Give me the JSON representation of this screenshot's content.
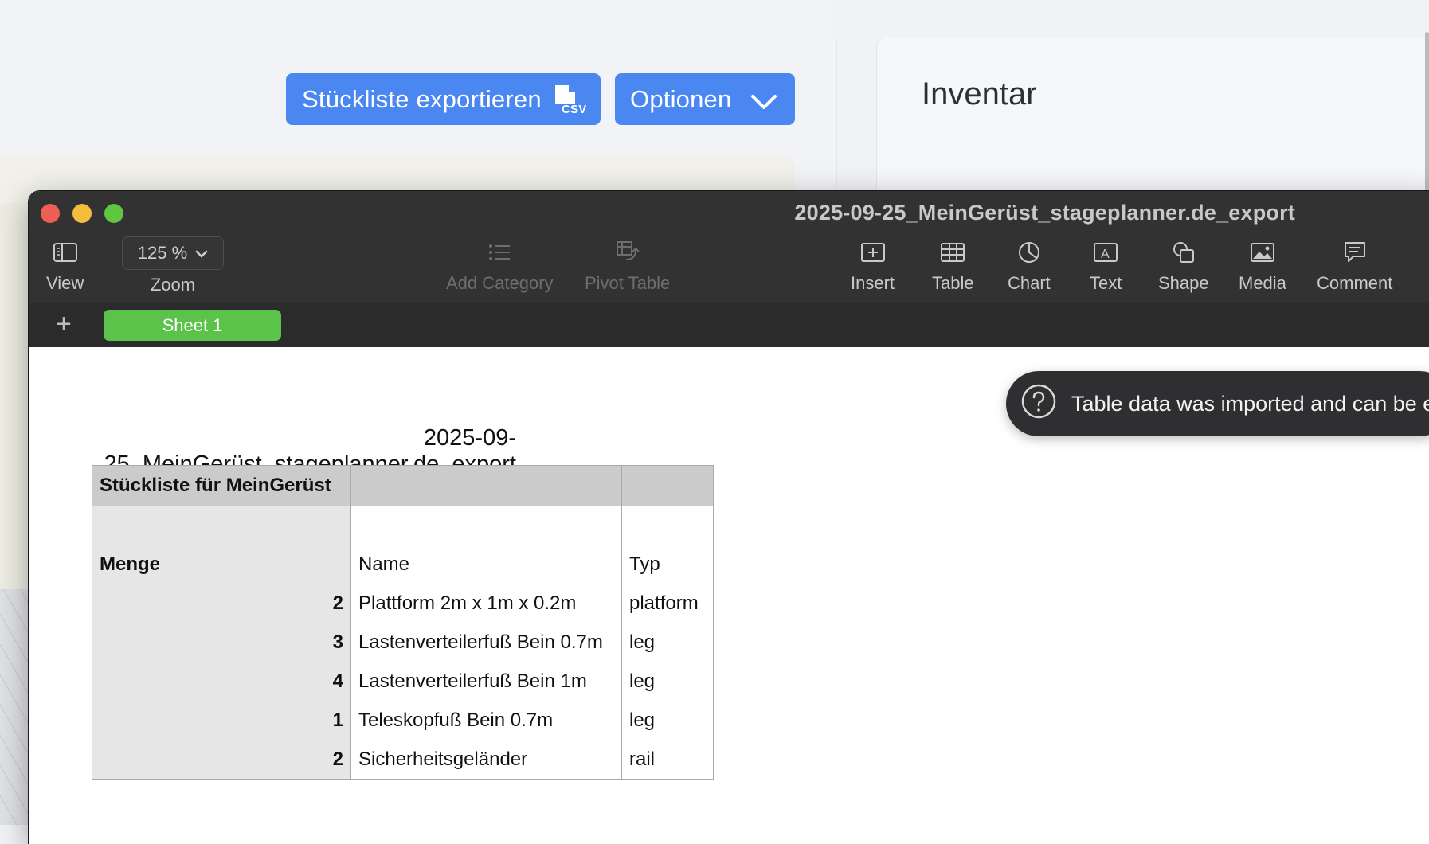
{
  "app": {
    "export_button_label": "Stückliste exportieren",
    "options_button_label": "Optionen",
    "inventory_title": "Inventar"
  },
  "window": {
    "title": "2025-09-25_MeinGerüst_stageplanner.de_export",
    "toolbar": {
      "view": "View",
      "zoom_value": "125 %",
      "zoom": "Zoom",
      "add_category": "Add Category",
      "pivot_table": "Pivot Table",
      "insert": "Insert",
      "table": "Table",
      "chart": "Chart",
      "text": "Text",
      "shape": "Shape",
      "media": "Media",
      "comment": "Comment"
    },
    "sheet_tab": "Sheet 1",
    "doc_title": "2025-09-25_MeinGerüst_stageplanner.de_export",
    "toast": "Table data was imported and can be edited"
  },
  "table": {
    "header": [
      "Stückliste für MeinGerüst",
      "",
      ""
    ],
    "blank_row": [
      "",
      "",
      ""
    ],
    "column_row": [
      "Menge",
      "Name",
      "Typ"
    ],
    "rows": [
      {
        "qty": "2",
        "name": "Plattform 2m x 1m x 0.2m",
        "type": "platform"
      },
      {
        "qty": "3",
        "name": "Lastenverteilerfuß Bein 0.7m",
        "type": "leg"
      },
      {
        "qty": "4",
        "name": "Lastenverteilerfuß Bein 1m",
        "type": "leg"
      },
      {
        "qty": "1",
        "name": "Teleskopfuß Bein 0.7m",
        "type": "leg"
      },
      {
        "qty": "2",
        "name": "Sicherheitsgeländer",
        "type": "rail"
      }
    ]
  },
  "colors": {
    "button_blue": "#4b87f0",
    "sheet_tab_green": "#5bc24a",
    "titlebar": "#323232"
  }
}
